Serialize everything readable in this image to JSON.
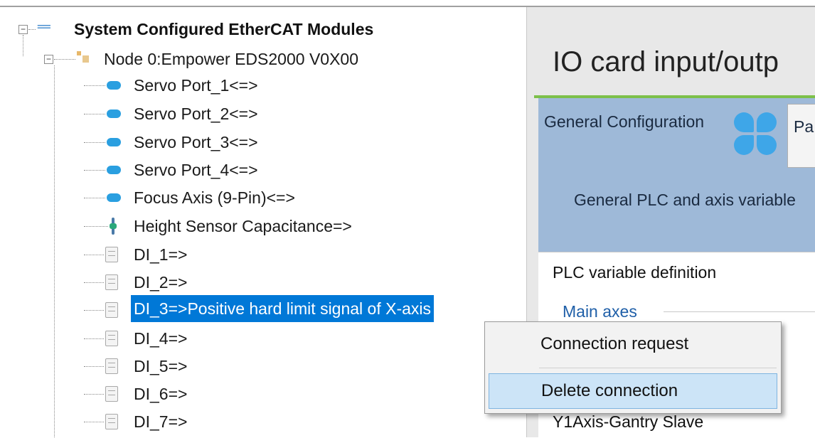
{
  "tree": {
    "root": {
      "icon": "module-group-icon",
      "glyph": "==",
      "label": "System Configured EtherCAT Modules"
    },
    "node": {
      "icon": "node-icon",
      "label": "Node 0:Empower EDS2000 V0X00"
    },
    "children": [
      {
        "icon": "servo-port-icon",
        "label": "Servo Port_1<=>"
      },
      {
        "icon": "servo-port-icon",
        "label": "Servo Port_2<=>"
      },
      {
        "icon": "servo-port-icon",
        "label": "Servo Port_3<=>"
      },
      {
        "icon": "servo-port-icon",
        "label": "Servo Port_4<=>"
      },
      {
        "icon": "servo-port-icon",
        "label": "Focus Axis (9-Pin)<=>"
      },
      {
        "icon": "sensor-icon",
        "label": "Height Sensor Capacitance=>"
      },
      {
        "icon": "digital-input-icon",
        "label": "DI_1=>"
      },
      {
        "icon": "digital-input-icon",
        "label": "DI_2=>"
      },
      {
        "icon": "digital-input-icon",
        "label": "DI_3=>Positive hard limit signal of X-axis",
        "selected": true
      },
      {
        "icon": "digital-input-icon",
        "label": "DI_4=>"
      },
      {
        "icon": "digital-input-icon",
        "label": "DI_5=>"
      },
      {
        "icon": "digital-input-icon",
        "label": "DI_6=>"
      },
      {
        "icon": "digital-input-icon",
        "label": "DI_7=>"
      }
    ],
    "expander_symbol": "−",
    "selection_color": "#0078d7"
  },
  "right_panel": {
    "title": "IO card input/outp",
    "tab_general": "General Configuration",
    "tab_partial": "Pa",
    "description": "General PLC and axis variable",
    "plc_definition": "PLC variable definition",
    "main_axes": "Main axes",
    "y1_label": "Y1Axis-Gantry Slave",
    "accent_color": "#7dc04a",
    "panel_color": "#9eb9d8"
  },
  "context_menu": {
    "items": [
      {
        "label": "Connection request"
      },
      {
        "label": "Delete connection",
        "highlighted": true
      }
    ]
  }
}
